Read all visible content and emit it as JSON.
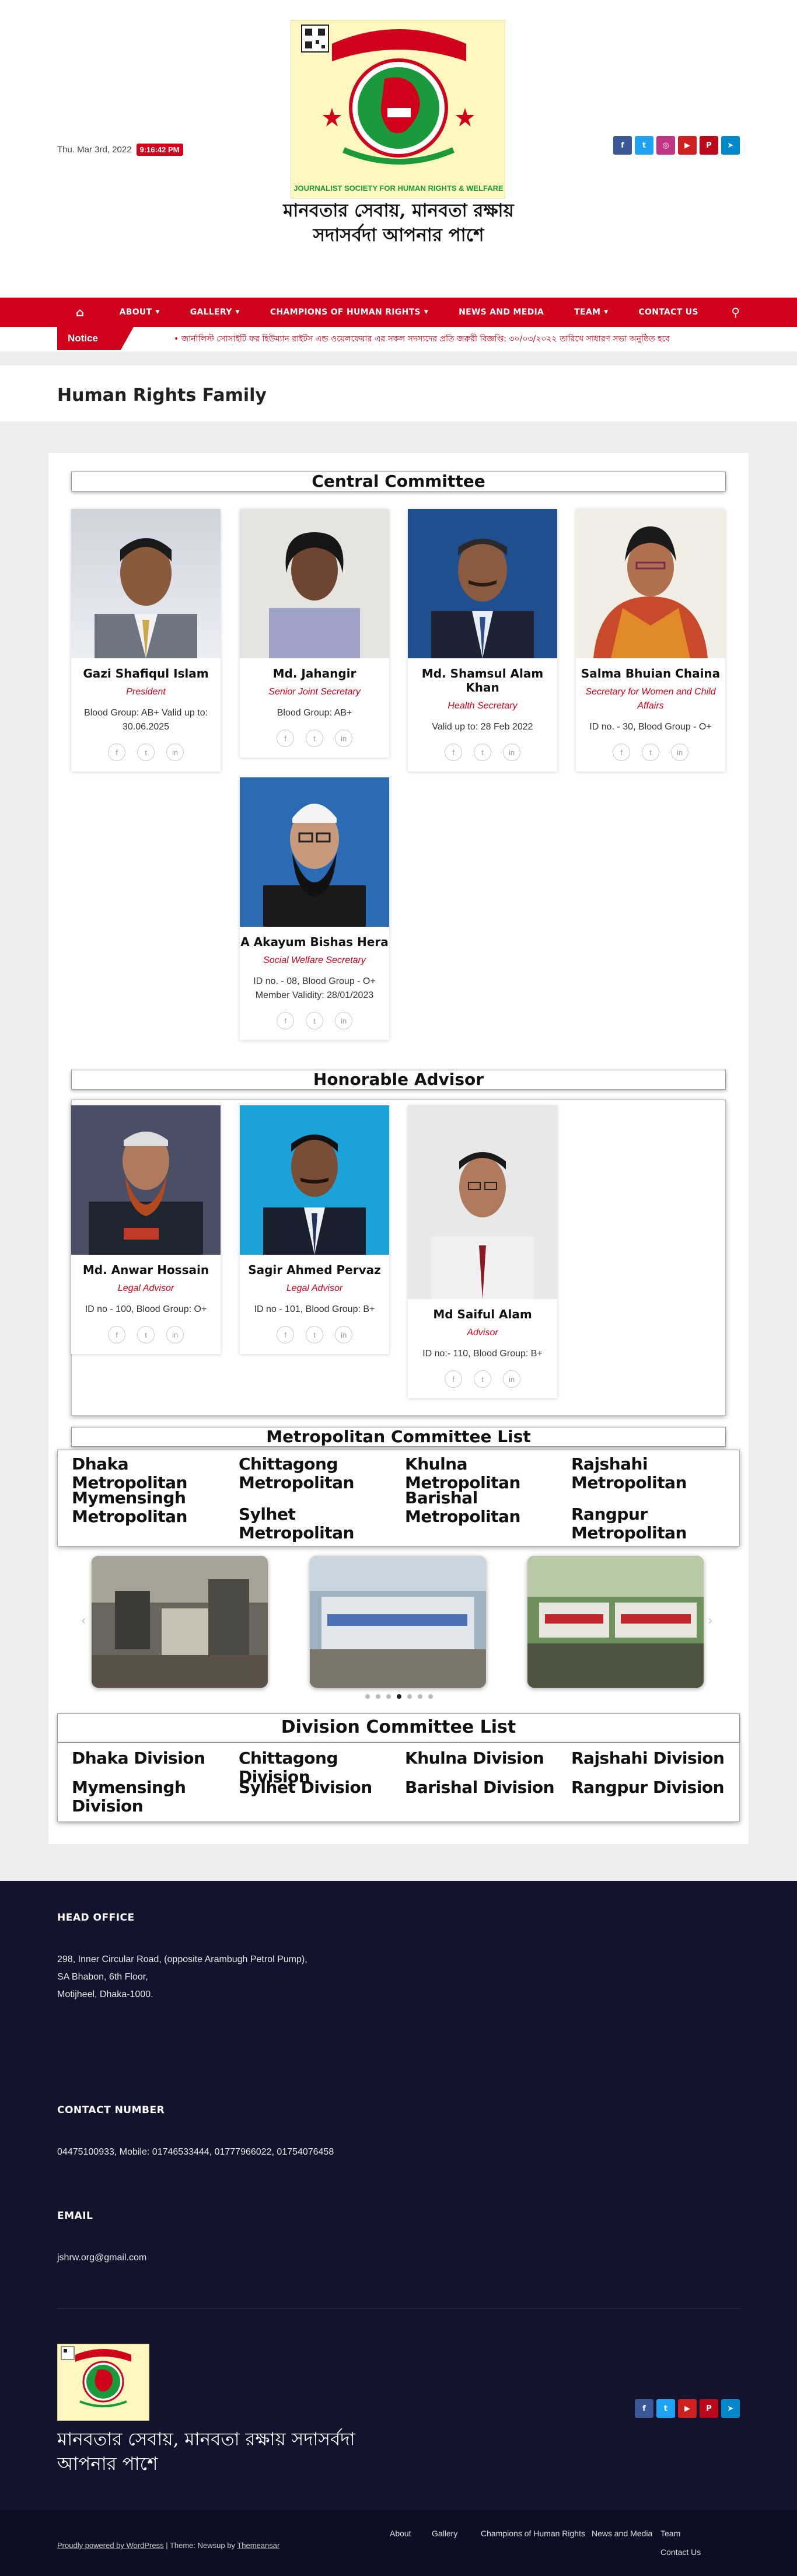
{
  "header": {
    "date": "Thu. Mar 3rd, 2022",
    "time": "9:16:42 PM",
    "logo_text": "JOURNALIST SOCIETY FOR HUMAN RIGHTS & WELFARE",
    "tagline": "মানবতার সেবায়, মানবতা রক্ষায় সদাসর্বদা আপনার পাশে",
    "social": [
      "facebook-icon",
      "twitter-icon",
      "instagram-icon",
      "youtube-icon",
      "pinterest-icon",
      "telegram-icon"
    ]
  },
  "nav": {
    "items": [
      "ABOUT",
      "GALLERY",
      "CHAMPIONS OF HUMAN RIGHTS",
      "NEWS AND MEDIA",
      "TEAM",
      "CONTACT US"
    ],
    "dropdowns": [
      true,
      true,
      true,
      false,
      true,
      false
    ]
  },
  "ticker": {
    "label": "Notice",
    "text": "• জার্নালিস্ট সোসাইটি ফর হিউম্যান রাইটস এন্ড ওয়েলফেয়ার এর সকল সদস্যদের প্রতি জরুরী বিজ্ঞপ্তি: ৩০/০৩/২০২২ তারিখে সাধারণ সভা অনুষ্ঠিত হবে"
  },
  "page": {
    "title": "Human Rights Family"
  },
  "central": {
    "heading": "Central Committee",
    "members": [
      {
        "name": "Gazi Shafiqul Islam",
        "role": "President",
        "info": [
          "Blood Group: AB+  Valid up to:",
          "30.06.2025"
        ]
      },
      {
        "name": "Md. Jahangir",
        "role": "Senior Joint Secretary",
        "info": [
          "Blood Group: AB+"
        ]
      },
      {
        "name": "Md. Shamsul Alam Khan",
        "role": "Health Secretary",
        "info": [
          "Valid up to: 28 Feb 2022"
        ]
      },
      {
        "name": "Salma Bhuian Chaina",
        "role": "Secretary for Women and Child Affairs",
        "info": [
          "ID no. - 30, Blood Group - O+"
        ]
      },
      {
        "name": "A Akayum Bishas Hera",
        "role": "Social Welfare Secretary",
        "info": [
          "ID no. - 08, Blood Group - O+",
          "Member Validity: 28/01/2023"
        ]
      }
    ]
  },
  "advisor": {
    "heading": "Honorable Advisor",
    "members": [
      {
        "name": "Md. Anwar Hossain",
        "role": "Legal Advisor",
        "info": [
          "ID no - 100, Blood Group: O+"
        ]
      },
      {
        "name": "Sagir Ahmed Pervaz",
        "role": "Legal Advisor",
        "info": [
          "ID no - 101, Blood Group: B+"
        ]
      },
      {
        "name": "Md Saiful Alam",
        "role": "Advisor",
        "info": [
          "ID no:- 110, Blood Group: B+"
        ]
      }
    ]
  },
  "metro": {
    "heading": "Metropolitan Committee List",
    "items": [
      "Dhaka Metropolitan",
      "Chittagong Metropolitan",
      "Khulna Metropolitan",
      "Rajshahi Metropolitan",
      "Mymensingh Metropolitan",
      "Sylhet Metropolitan",
      "Barishal Metropolitan",
      "Rangpur Metropolitan"
    ]
  },
  "division": {
    "heading": "Division Committee List",
    "items": [
      "Dhaka Division",
      "Chittagong Division",
      "Khulna Division",
      "Rajshahi Division",
      "Mymensingh Division",
      "Sylhet Division",
      "Barishal Division",
      "Rangpur Division"
    ]
  },
  "footer": {
    "office_heading": "HEAD OFFICE",
    "office_lines": [
      "298, Inner Circular Road, (opposite Arambugh Petrol Pump),",
      "SA Bhabon, 6th Floor,",
      "Motijheel, Dhaka-1000."
    ],
    "contact_heading": "CONTACT NUMBER",
    "contact": "04475100933, Mobile: 01746533444, 01777966022, 01754076458",
    "email_heading": "EMAIL",
    "email": "jshrw.org@gmail.com",
    "tagline": "মানবতার সেবায়, মানবতা রক্ষায় সদাসর্বদা আপনার পাশে",
    "copyright_link": "Proudly powered by WordPress",
    "copyright_theme": " | Theme: Newsup by ",
    "copyright_author": "Themeansar",
    "menu": [
      "About",
      "Gallery",
      "Champions of Human Rights",
      "News and Media",
      "Team",
      "Contact Us"
    ]
  },
  "colors": {
    "brand_red": "#d0021b",
    "footer_bg": "#13132e"
  }
}
